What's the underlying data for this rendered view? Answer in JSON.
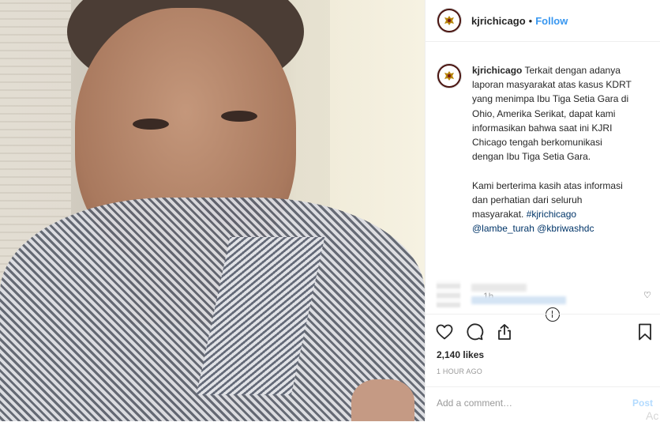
{
  "post": {
    "username": "kjrichicago",
    "separator": "•",
    "follow_label": "Follow",
    "caption_prefix": "Terkait dengan adanya\nlaporan masyarakat atas kasus KDRT\nyang menimpa Ibu Tiga Setia Gara di\nOhio, Amerika Serikat, dapat kami\ninformasikan bahwa saat ini KJRI\nChicago tengah berkomunikasi\ndengan Ibu Tiga Setia Gara.\n\nKami berterima kasih atas informasi\ndan perhatian dari seluruh\nmasyarakat.",
    "hashtag": "#kjrichicago",
    "mention1": "@lambe_turah",
    "mention2": "@kbriwashdc",
    "caption_time": "1h",
    "likes": "2,140 likes",
    "time_ago": "1 HOUR AGO",
    "comment_placeholder": "Add a comment…",
    "post_label": "Post",
    "ghost_text": "Ac"
  },
  "icons": {
    "like": "heart-icon",
    "comment": "comment-icon",
    "share": "share-icon",
    "save": "bookmark-icon",
    "more": "plus-circle-icon"
  },
  "colors": {
    "link": "#3897f0",
    "muted": "#999999"
  }
}
